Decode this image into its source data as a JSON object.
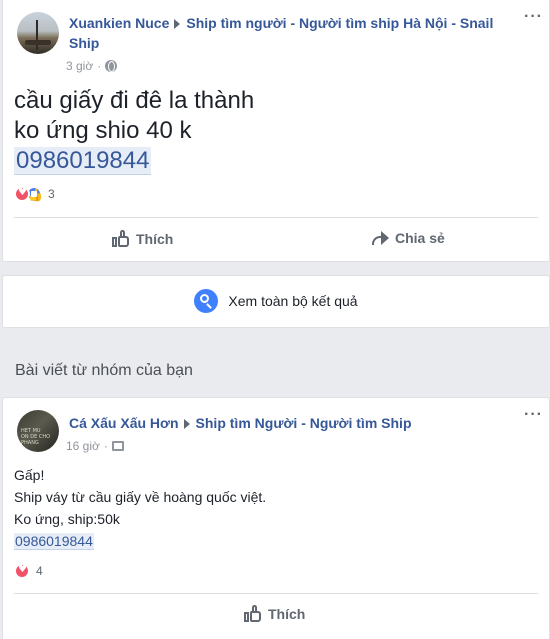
{
  "post1": {
    "author": "Xuankien Nuce",
    "group": "Ship tìm người - Người tìm ship Hà Nội - Snail Ship",
    "time": "3 giờ",
    "privacy_icon": "globe-icon",
    "lines": [
      "cầu giấy đi đê la thành",
      "ko ứng shio 40 k"
    ],
    "phone": "0986019844",
    "reaction_count": "3",
    "like_label": "Thích",
    "share_label": "Chia sẻ"
  },
  "see_all": {
    "label": "Xem toàn bộ kết quả"
  },
  "section": {
    "title": "Bài viết từ nhóm của bạn"
  },
  "post2": {
    "author": "Cá Xấu Xấu Hơn",
    "group": "Ship tìm Người - Người tìm Ship",
    "time": "16 giờ",
    "privacy_icon": "group-icon",
    "lines": [
      "Gấp!",
      "Ship váy từ cầu giấy về hoàng quốc việt.",
      "Ko ứng, ship:50k"
    ],
    "phone": "0986019844",
    "reaction_count": "4",
    "like_label": "Thích"
  },
  "colors": {
    "link_blue": "#365899",
    "muted_gray": "#90949c",
    "love_red": "#f25268",
    "like_blue": "#4f7df2",
    "search_blue": "#4080ff",
    "page_bg": "#e9ebee"
  }
}
